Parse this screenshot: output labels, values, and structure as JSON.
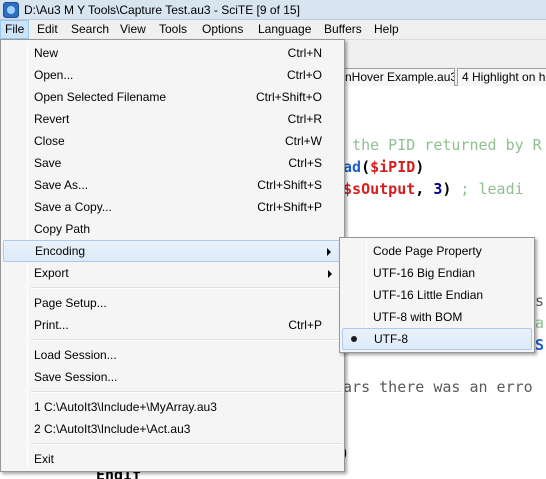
{
  "window": {
    "title": "D:\\Au3 M Y Tools\\Capture Test.au3 - SciTE [9 of 15]"
  },
  "menubar": [
    "File",
    "Edit",
    "Search",
    "View",
    "Tools",
    "Options",
    "Language",
    "Buffers",
    "Help"
  ],
  "tabs": [
    "nHover Example.au3",
    "4 Highlight on h"
  ],
  "editor": {
    "line1": "f the PID returned by R",
    "line2_func": "ead",
    "line2_open": "(",
    "line2_var": "$iPID",
    "line2_close": ")",
    "line3_open": "(",
    "line3_var": "$sOutput",
    "line3_comma": ", ",
    "line3_num": "3",
    "line3_close": ")",
    "line3_rest": " ; leadi",
    "frag_a": "s",
    "frag_b": "a",
    "frag_c": "S",
    "line_err": "ears there was an erro",
    "frag_paren": ")",
    "frag_bottom": "EndIf"
  },
  "file_menu": {
    "items": [
      {
        "label": "New",
        "shortcut": "Ctrl+N"
      },
      {
        "label": "Open...",
        "shortcut": "Ctrl+O"
      },
      {
        "label": "Open Selected Filename",
        "shortcut": "Ctrl+Shift+O"
      },
      {
        "label": "Revert",
        "shortcut": "Ctrl+R"
      },
      {
        "label": "Close",
        "shortcut": "Ctrl+W"
      },
      {
        "label": "Save",
        "shortcut": "Ctrl+S"
      },
      {
        "label": "Save As...",
        "shortcut": "Ctrl+Shift+S"
      },
      {
        "label": "Save a Copy...",
        "shortcut": "Ctrl+Shift+P"
      },
      {
        "label": "Copy Path",
        "shortcut": ""
      },
      {
        "label": "Encoding",
        "shortcut": ""
      },
      {
        "label": "Export",
        "shortcut": ""
      },
      {
        "label": "Page Setup...",
        "shortcut": ""
      },
      {
        "label": "Print...",
        "shortcut": "Ctrl+P"
      },
      {
        "label": "Load Session...",
        "shortcut": ""
      },
      {
        "label": "Save Session...",
        "shortcut": ""
      },
      {
        "label": "1 C:\\AutoIt3\\Include+\\MyArray.au3",
        "shortcut": ""
      },
      {
        "label": "2 C:\\AutoIt3\\Include+\\Act.au3",
        "shortcut": ""
      },
      {
        "label": "Exit",
        "shortcut": ""
      }
    ]
  },
  "encoding_menu": {
    "items": [
      {
        "label": "Code Page Property"
      },
      {
        "label": "UTF-16 Big Endian"
      },
      {
        "label": "UTF-16 Little Endian"
      },
      {
        "label": "UTF-8 with BOM"
      },
      {
        "label": "UTF-8"
      }
    ],
    "selected": "UTF-8"
  }
}
